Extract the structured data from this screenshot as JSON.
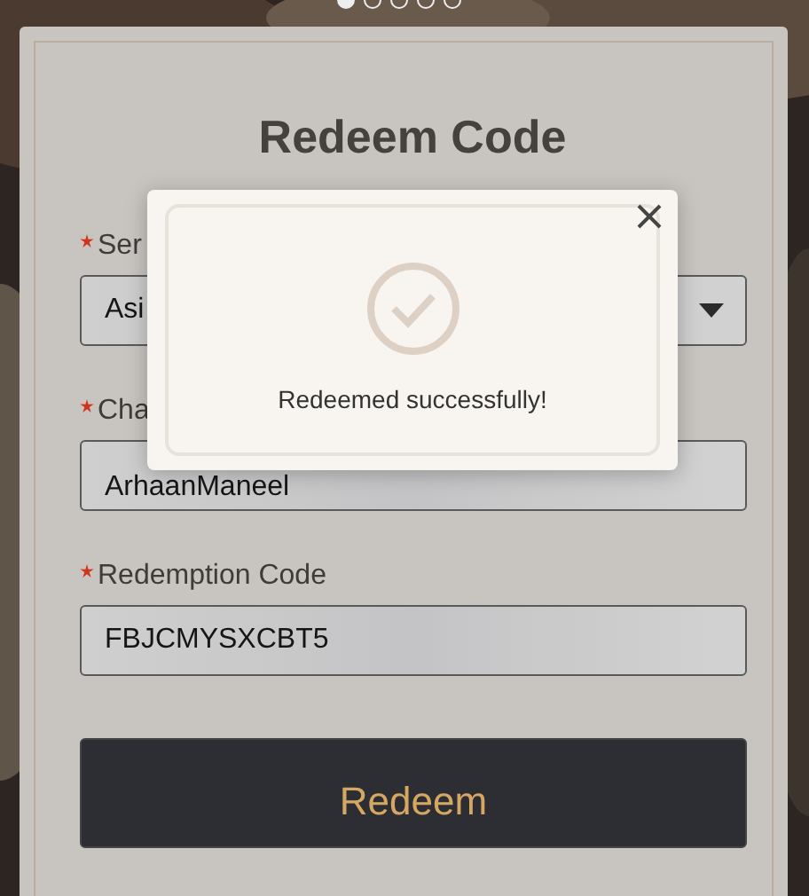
{
  "pager": [
    {
      "selected": true
    },
    {
      "selected": false
    },
    {
      "selected": false
    },
    {
      "selected": false
    },
    {
      "selected": false
    }
  ],
  "form": {
    "title": "Redeem Code",
    "fields": [
      {
        "label": "Ser",
        "required": true,
        "kind": "select",
        "value": "Asi"
      },
      {
        "label": "Cha",
        "required": true,
        "kind": "text",
        "value": "ArhaanManeel"
      },
      {
        "label": "Redemption Code",
        "required": true,
        "kind": "text",
        "value": "FBJCMYSXCBT5"
      }
    ],
    "submit": "Redeem"
  },
  "dialog": {
    "message": "Redeemed successfully!"
  }
}
